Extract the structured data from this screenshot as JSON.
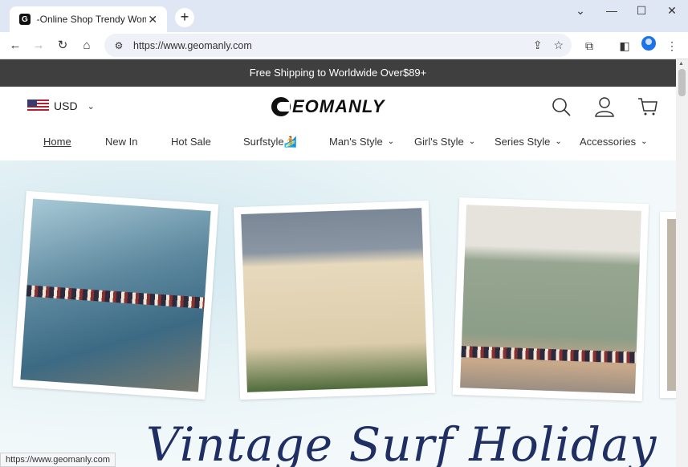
{
  "browser": {
    "tab_title": "-Online Shop Trendy Women's",
    "tab_close": "✕",
    "new_tab": "+",
    "url": "https://www.geomanly.com",
    "status_url": "https://www.geomanly.com",
    "window_controls": [
      "⌄",
      "—",
      "☐",
      "✕"
    ]
  },
  "site": {
    "announcement": "Free Shipping to Worldwide Over$89+",
    "currency": "USD",
    "logo": "EOMANLY",
    "nav": [
      {
        "label": "Home"
      },
      {
        "label": "New In"
      },
      {
        "label": "Hot Sale"
      },
      {
        "label": "Surfstyle🏄"
      },
      {
        "label": "Man's Style"
      },
      {
        "label": "Girl's Style"
      },
      {
        "label": "Series Style"
      },
      {
        "label": "Accessories"
      }
    ],
    "hero_title": "Vintage Surf Holiday"
  }
}
